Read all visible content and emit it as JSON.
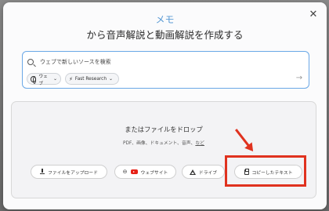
{
  "dialog": {
    "brand": "メモ",
    "headline": "から音声解説と動画解説を作成する"
  },
  "search": {
    "placeholder": "ウェブで新しいソースを検索",
    "source_chip": "ウェブ",
    "mode_chip": "Fast Research"
  },
  "drop_zone": {
    "title": "またはファイルをドロップ",
    "formats": "PDF、画像、ドキュメント、音声、",
    "more_link": "など",
    "buttons": {
      "upload": "ファイルをアップロード",
      "website": "ウェブサイト",
      "drive": "ドライブ",
      "copied_text": "コピーしたテキスト"
    }
  },
  "annotation": {
    "color": "#e0321f"
  },
  "icons": [
    "close-icon",
    "search-icon",
    "globe-icon",
    "research-icon",
    "submit-arrow-icon",
    "upload-icon",
    "link-icon",
    "youtube-icon",
    "drive-icon",
    "clipboard-icon"
  ]
}
